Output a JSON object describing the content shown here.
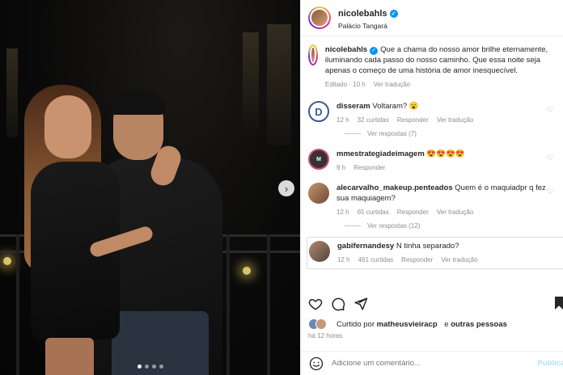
{
  "post": {
    "username": "nicolebahls",
    "location": "Palácio Tangará",
    "caption_user": "nicolebahls",
    "caption_text": "Que a chama do nosso amor brilhe eternamente, iluminando cada passo do nosso caminho. Que essa noite seja apenas o começo de uma história de amor inesquecível.",
    "caption_edited": "Editado · 10 h",
    "caption_translate": "Ver tradução",
    "carousel": {
      "total": 4,
      "active": 0
    }
  },
  "comments": [
    {
      "user": "disseram",
      "text": "Voltaram? 😮",
      "time": "12 h",
      "likes": "32 curtidas",
      "reply": "Responder",
      "translate": "Ver tradução",
      "view_replies": "Ver respostas (7)"
    },
    {
      "user": "mmestrategiadeimagem",
      "text": "😍😍😍😍",
      "time": "9 h",
      "reply": "Responder"
    },
    {
      "user": "alecarvalho_makeup.penteados",
      "text": "Quem é o maquiadpr q fez sua maquiagem?",
      "time": "12 h",
      "likes": "65 curtidas",
      "reply": "Responder",
      "translate": "Ver tradução",
      "view_replies": "Ver respostas (12)"
    },
    {
      "user": "gabifernandesy",
      "text": "N tinha separado?",
      "time": "12 h",
      "likes": "461 curtidas",
      "reply": "Responder",
      "translate": "Ver tradução"
    }
  ],
  "likes_line": {
    "prefix": "Curtido por",
    "user": "matheusvieiracp",
    "joiner": "e",
    "others": "outras pessoas"
  },
  "time_ago": "há 12 horas",
  "add_comment": {
    "placeholder": "Adicione um comentário...",
    "publish": "Publicar"
  },
  "colors": {
    "accent": "#0095f6",
    "muted": "#8e8e8e",
    "publish_disabled": "#b2dffc"
  }
}
